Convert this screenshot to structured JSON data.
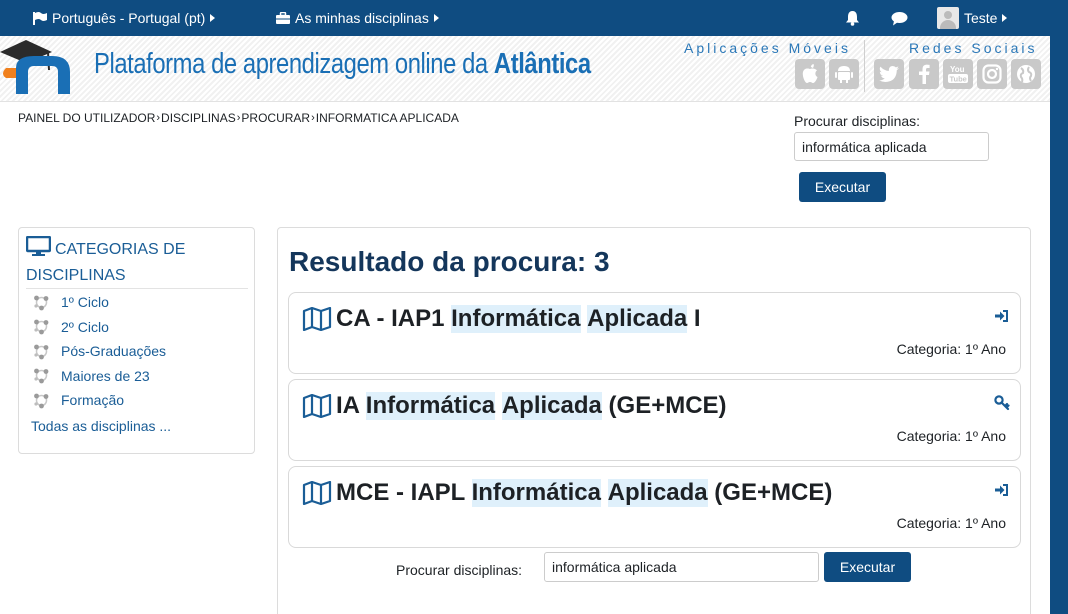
{
  "navbar": {
    "language": "Português - Portugal (pt)",
    "my_courses": "As minhas disciplinas",
    "user_name": "Teste"
  },
  "header": {
    "title_prefix": "Plataforma de aprendizagem online da ",
    "title_brand": "Atlântica",
    "mobile_apps_label": "Aplicações Móveis",
    "social_label": "Redes Sociais",
    "mobile_icons": [
      "apple-icon",
      "android-icon"
    ],
    "social_icons": [
      "twitter-icon",
      "facebook-icon",
      "youtube-icon",
      "instagram-icon",
      "globe-icon"
    ]
  },
  "breadcrumb": {
    "items": [
      "PAINEL DO UTILIZADOR",
      "DISCIPLINAS",
      "PROCURAR",
      "INFORMATICA APLICADA"
    ]
  },
  "search_top": {
    "label": "Procurar disciplinas:",
    "value": "informática aplicada",
    "button": "Executar"
  },
  "sidebar": {
    "title": "CATEGORIAS DE DISCIPLINAS",
    "categories": [
      "1º Ciclo",
      "2º Ciclo",
      "Pós-Graduações",
      "Maiores de 23",
      "Formação"
    ],
    "all_link": "Todas as disciplinas ..."
  },
  "results": {
    "heading": "Resultado da procura: 3",
    "courses": [
      {
        "prefix": "CA - IAP1 ",
        "hl1": "Informática",
        "hl2": "Aplicada",
        "suffix": " I",
        "category": "Categoria: 1º Ano",
        "icon": "enrol-icon"
      },
      {
        "prefix": "IA ",
        "hl1": "Informática",
        "hl2": "Aplicada",
        "suffix": " (GE+MCE)",
        "category": "Categoria: 1º Ano",
        "icon": "key-icon"
      },
      {
        "prefix": "MCE - IAPL ",
        "hl1": "Informática",
        "hl2": "Aplicada",
        "suffix": " (GE+MCE)",
        "category": "Categoria: 1º Ano",
        "icon": "enrol-icon"
      }
    ]
  },
  "search_bottom": {
    "label": "Procurar disciplinas:",
    "value": "informática aplicada",
    "button": "Executar"
  },
  "colors": {
    "primary": "#0f4c81",
    "link": "#1a5d96",
    "highlight": "#dff0fb",
    "brand_blue": "#1a6fb5"
  }
}
